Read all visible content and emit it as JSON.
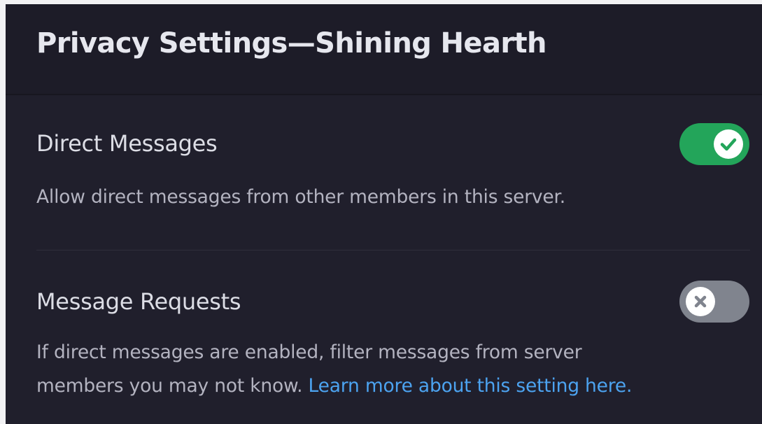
{
  "header": {
    "title": "Privacy Settings—Shining Hearth"
  },
  "settings": [
    {
      "title": "Direct Messages",
      "description": "Allow direct messages from other members in this server.",
      "toggle_state": "on",
      "toggle_icon": "check-icon"
    },
    {
      "title": "Message Requests",
      "description_line1": "If direct messages are enabled, filter messages from server",
      "description_line2": "members you may not know.",
      "link_text": "Learn more about this setting here.",
      "toggle_state": "off",
      "toggle_icon": "x-icon"
    }
  ],
  "colors": {
    "toggle_on": "#23a55a",
    "toggle_off": "#80848e",
    "link": "#4ca3f0",
    "background": "#201f2c"
  }
}
